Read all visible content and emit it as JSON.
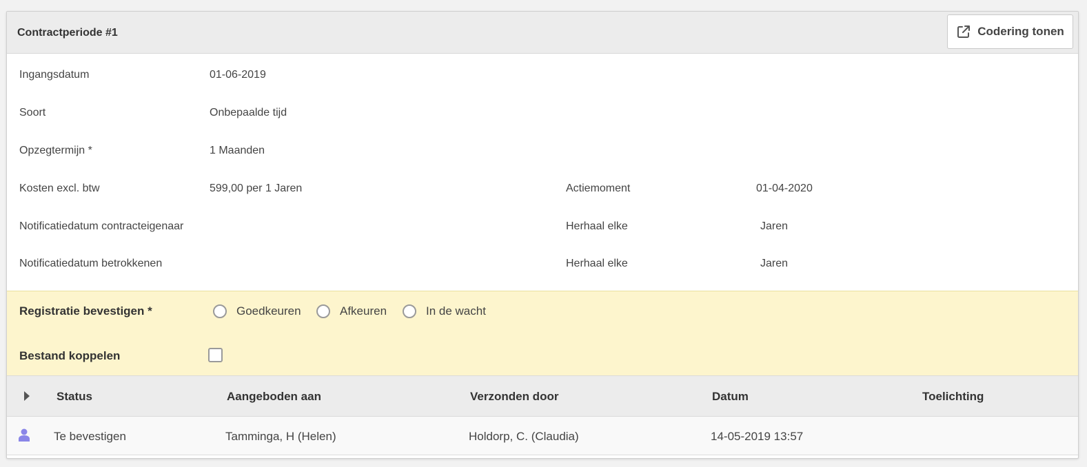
{
  "header": {
    "title": "Contractperiode #1",
    "code_button_label": "Codering tonen",
    "code_button_icon": "external-link-icon"
  },
  "details": {
    "start_date_label": "Ingangsdatum",
    "start_date_value": "01-06-2019",
    "type_label": "Soort",
    "type_value": "Onbepaalde tijd",
    "notice_label": "Opzegtermijn *",
    "notice_value": "1 Maanden",
    "cost_label": "Kosten excl. btw",
    "cost_value": "599,00 per 1 Jaren",
    "action_label": "Actiemoment",
    "action_value": "01-04-2020",
    "notif_owner_label": "Notificatiedatum contracteigenaar",
    "notif_owner_value": "",
    "repeat_owner_label": "Herhaal elke",
    "repeat_owner_value": "Jaren",
    "notif_involved_label": "Notificatiedatum betrokkenen",
    "notif_involved_value": "",
    "repeat_involved_label": "Herhaal elke",
    "repeat_involved_value": "Jaren"
  },
  "confirmation": {
    "label": "Registratie bevestigen *",
    "options": [
      "Goedkeuren",
      "Afkeuren",
      "In de wacht"
    ],
    "selected": null,
    "attach_label": "Bestand koppelen",
    "attach_checked": false,
    "background_color": "#fdf5cd"
  },
  "table": {
    "headers": [
      "Status",
      "Aangeboden aan",
      "Verzonden door",
      "Datum",
      "Toelichting"
    ],
    "rows": [
      {
        "icon": "user-icon",
        "icon_color": "#8a86e8",
        "status": "Te bevestigen",
        "offered_to": "Tamminga, H (Helen)",
        "sent_by": "Holdorp, C. (Claudia)",
        "date": "14-05-2019 13:57",
        "note": ""
      }
    ]
  }
}
